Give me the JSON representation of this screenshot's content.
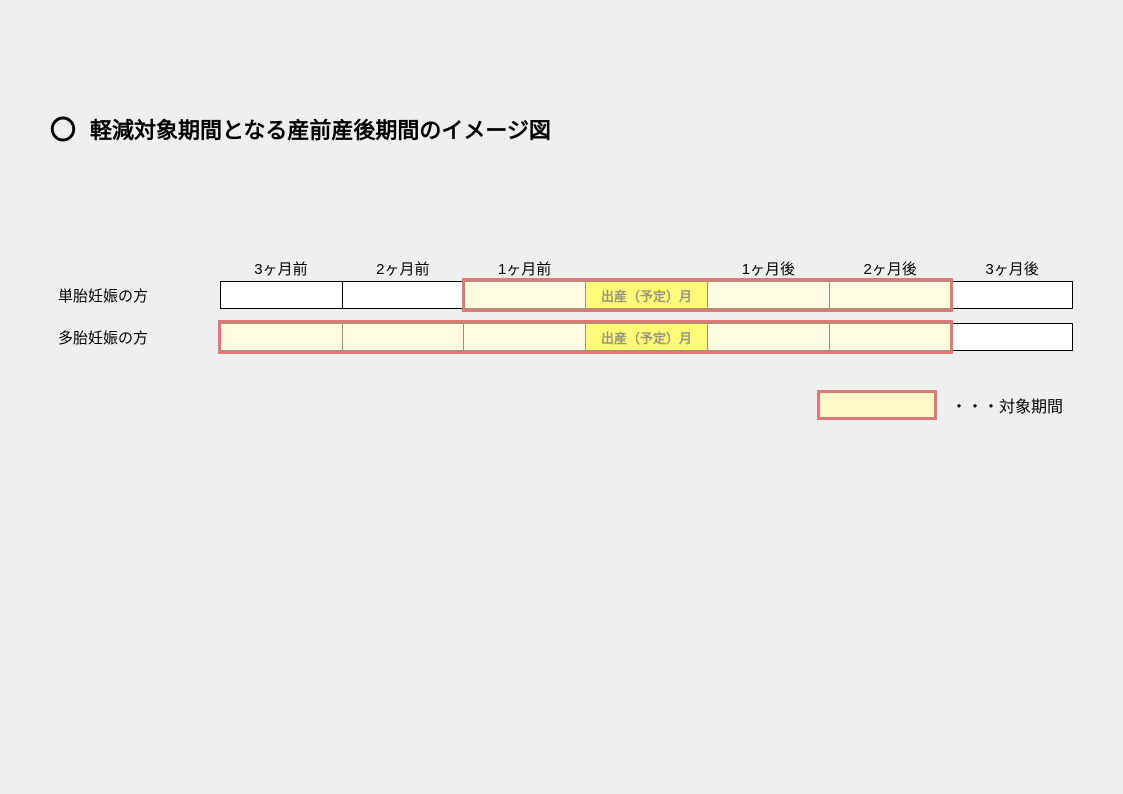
{
  "title_bullet": "〇",
  "title": "軽減対象期間となる産前産後期間のイメージ図",
  "headers": [
    "3ヶ月前",
    "2ヶ月前",
    "1ヶ月前",
    "",
    "1ヶ月後",
    "2ヶ月後",
    "3ヶ月後"
  ],
  "rows": {
    "single": {
      "label": "単胎妊娠の方",
      "birth_label": "出産（予定）月"
    },
    "multi": {
      "label": "多胎妊娠の方",
      "birth_label": "出産（予定）月"
    }
  },
  "legend": {
    "label": "・・・対象期間"
  },
  "chart_data": {
    "type": "table",
    "title": "軽減対象期間となる産前産後期間のイメージ図",
    "columns": [
      "3ヶ月前",
      "2ヶ月前",
      "1ヶ月前",
      "出産（予定）月",
      "1ヶ月後",
      "2ヶ月後",
      "3ヶ月後"
    ],
    "series": [
      {
        "name": "単胎妊娠の方",
        "covered_months": [
          "1ヶ月前",
          "出産（予定）月",
          "1ヶ月後",
          "2ヶ月後"
        ]
      },
      {
        "name": "多胎妊娠の方",
        "covered_months": [
          "3ヶ月前",
          "2ヶ月前",
          "1ヶ月前",
          "出産（予定）月",
          "1ヶ月後",
          "2ヶ月後"
        ]
      }
    ],
    "legend": "対象期間",
    "highlight_color": "#e07878",
    "fill_color": "#fff8c8",
    "birth_month_color": "#ffff00"
  }
}
